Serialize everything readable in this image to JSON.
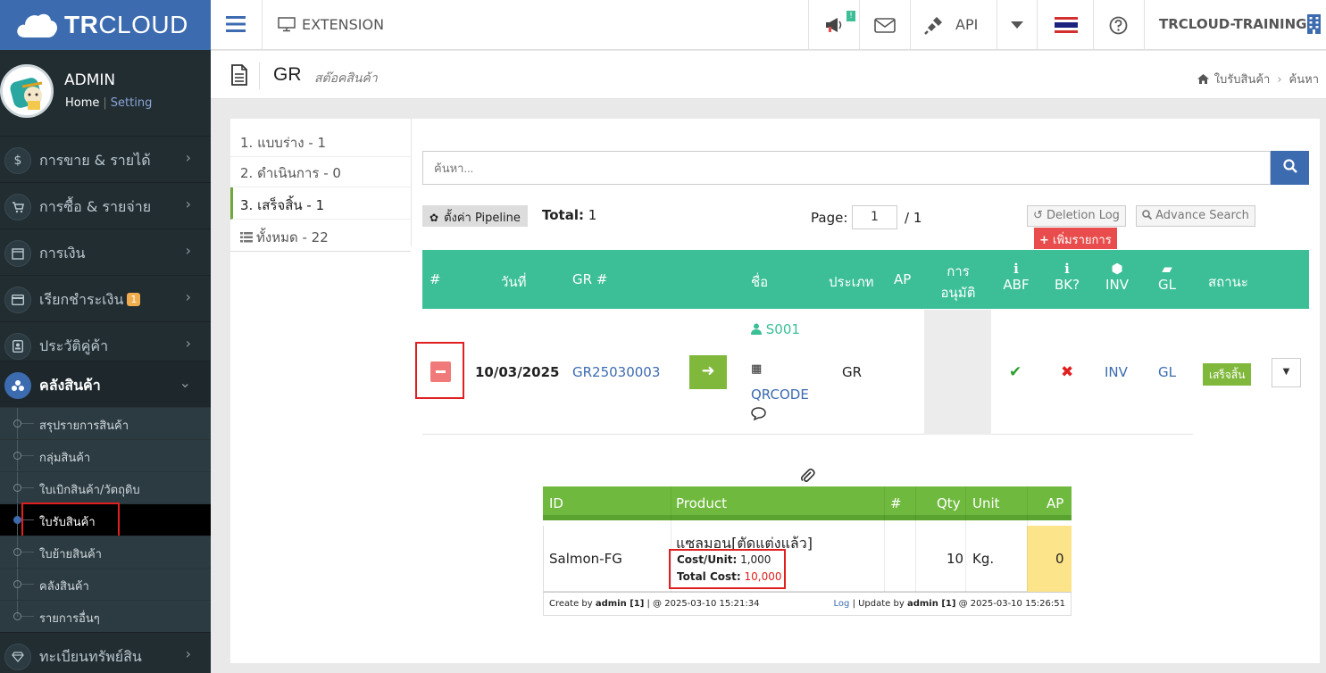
{
  "brand": {
    "logo_strong": "TR",
    "logo_rest": "CLOUD"
  },
  "user": {
    "name": "ADMIN",
    "home": "Home",
    "sep": "|",
    "setting": "Setting"
  },
  "sidebar": {
    "items": [
      {
        "label": "การขาย & รายได้",
        "icon": "dollar-icon"
      },
      {
        "label": "การซื้อ & รายจ่าย",
        "icon": "cart-icon"
      },
      {
        "label": "การเงิน",
        "icon": "calendar-icon"
      },
      {
        "label": "เรียกชำระเงิน",
        "icon": "card-icon",
        "badge": "1"
      },
      {
        "label": "ประวัติคู่ค้า",
        "icon": "contact-book-icon"
      },
      {
        "label": "คลังสินค้า",
        "icon": "boxes-icon"
      },
      {
        "label": "ทะเบียนทรัพย์สิน",
        "icon": "diamond-icon"
      }
    ],
    "sub_items": [
      {
        "label": "สรุปรายการสินค้า"
      },
      {
        "label": "กลุ่มสินค้า"
      },
      {
        "label": "ใบเบิกสินค้า/วัตถุดิบ"
      },
      {
        "label": "ใบรับสินค้า"
      },
      {
        "label": "ใบย้ายสินค้า"
      },
      {
        "label": "คลังสินค้า"
      },
      {
        "label": "รายการอื่นๆ"
      }
    ]
  },
  "topbar": {
    "extension": "EXTENSION",
    "notify_badge": "!",
    "api": "API",
    "company": "TRCLOUD-TRAINING"
  },
  "page": {
    "title": "GR",
    "subtitle": "สต๊อคสินค้า",
    "breadcrumb": [
      "ใบรับสินค้า",
      "ค้นหา"
    ]
  },
  "pipeline": [
    {
      "label": "1. แบบร่าง - 1"
    },
    {
      "label": "2. ดำเนินการ - 0"
    },
    {
      "label": "3. เสร็จสิ้น - 1"
    },
    {
      "label": "ทั้งหมด - 22"
    }
  ],
  "search": {
    "placeholder": "ค้นหา..."
  },
  "toolbar": {
    "pipeline_setting": "ตั้งค่า Pipeline",
    "total_label": "Total:",
    "total_value": "1",
    "page_label": "Page:",
    "page_value": "1",
    "page_of": "/ 1",
    "deletion_log": "Deletion Log",
    "advance_search": "Advance Search",
    "add_item": "เพิ่มรายการ"
  },
  "table": {
    "headers": [
      "#",
      "วันที่",
      "GR #",
      "ชื่อ",
      "ประเภท",
      "AP",
      "การ",
      "อนุมัติ",
      "ABF",
      "BK?",
      "INV",
      "GL",
      "สถานะ"
    ],
    "row": {
      "date": "10/03/2025",
      "gr_no": "GR25030003",
      "name": "S001",
      "qrcode": "QRCODE",
      "type": "GR",
      "inv": "INV",
      "gl": "GL",
      "status": "เสร็จสิ้น"
    }
  },
  "detail": {
    "headers": [
      "ID",
      "Product",
      "#",
      "Qty",
      "Unit",
      "AP"
    ],
    "row": {
      "id": "Salmon-FG",
      "product": "แซลมอน[ตัดแต่งแล้ว]",
      "cost_unit_label": "Cost/Unit:",
      "cost_unit_value": "1,000",
      "total_cost_label": "Total Cost:",
      "total_cost_value": "10,000",
      "qty": "10",
      "unit": "Kg.",
      "ap": "0"
    },
    "footer": {
      "create_prefix": "Create by",
      "create_user": "admin [1]",
      "create_time": "| @ 2025-03-10 15:21:34",
      "log": "Log",
      "update_prefix": "| Update by",
      "update_user": "admin [1]",
      "update_time": "@ 2025-03-10 15:26:51"
    }
  },
  "colors": {
    "brand_blue": "#3c6bb0",
    "table_header_teal": "#3cbf96",
    "detail_header_green": "#6fba3e",
    "status_green": "#80b83c",
    "danger_red": "#e84c4c",
    "ap_yellow": "#fce48a"
  }
}
